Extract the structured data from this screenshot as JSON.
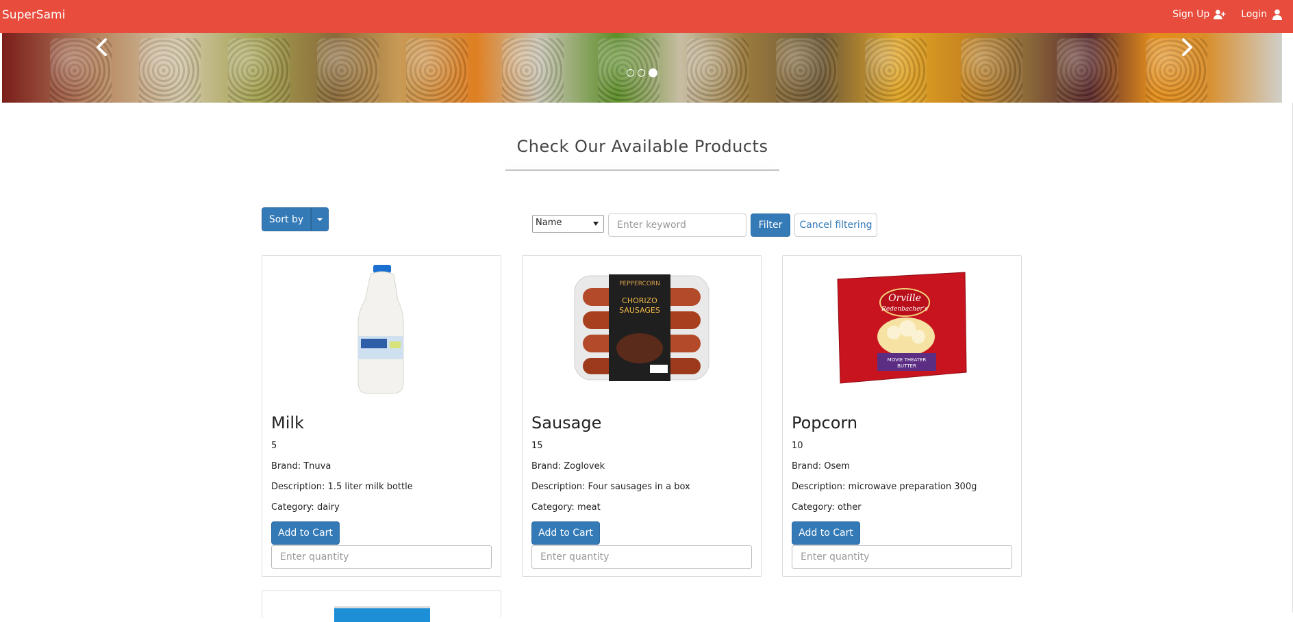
{
  "navbar": {
    "brand": "SuperSami",
    "signup_label": "Sign Up",
    "login_label": "Login",
    "color": "#e84c3d"
  },
  "carousel": {
    "prev_icon": "chevron-left-icon",
    "next_icon": "chevron-right-icon",
    "slide_count": 3,
    "active_slide": 3
  },
  "main": {
    "title": "Check Our Available Products"
  },
  "controls": {
    "sort_label": "Sort by",
    "filter_field_selected": "Name",
    "keyword_placeholder": "Enter keyword",
    "filter_label": "Filter",
    "cancel_label": "Cancel filtering"
  },
  "products": [
    {
      "name": "Milk",
      "price": "5",
      "brand": "Brand: Tnuva",
      "description": "Description: 1.5 liter milk bottle",
      "category": "Category: dairy",
      "add_label": "Add to Cart",
      "qty_placeholder": "Enter quantity"
    },
    {
      "name": "Sausage",
      "price": "15",
      "brand": "Brand: Zoglovek",
      "description": "Description: Four sausages in a box",
      "category": "Category: meat",
      "add_label": "Add to Cart",
      "qty_placeholder": "Enter quantity"
    },
    {
      "name": "Popcorn",
      "price": "10",
      "brand": "Brand: Osem",
      "description": "Description: microwave preparation 300g",
      "category": "Category: other",
      "add_label": "Add to Cart",
      "qty_placeholder": "Enter quantity"
    }
  ],
  "colors": {
    "primary": "#337ab7",
    "nav": "#e84c3d"
  }
}
